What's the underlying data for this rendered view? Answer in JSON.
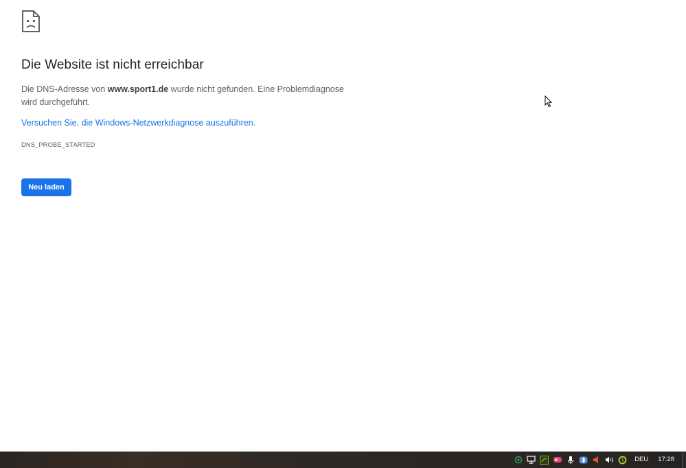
{
  "error": {
    "title": "Die Website ist nicht erreichbar",
    "desc_prefix": "Die DNS-Adresse von ",
    "domain": "www.sport1.de",
    "desc_suffix": " wurde nicht gefunden. Eine Problemdiagnose wird durchgeführt.",
    "diagnose_link": "Versuchen Sie, die Windows-Netzwerkdiagnose auszuführen.",
    "code": "DNS_PROBE_STARTED",
    "reload_label": "Neu laden"
  },
  "taskbar": {
    "tray_icons": [
      "network-status-icon",
      "display-icon",
      "nvidia-icon",
      "app-pink-icon",
      "microphone-icon",
      "bluetooth-icon",
      "speaker-warning-icon",
      "volume-icon",
      "update-icon"
    ],
    "language": "DEU",
    "clock": "17:28"
  },
  "colors": {
    "link": "#1a73e8",
    "button": "#1a73e8",
    "title": "#202124",
    "body_text": "#5f6368"
  }
}
